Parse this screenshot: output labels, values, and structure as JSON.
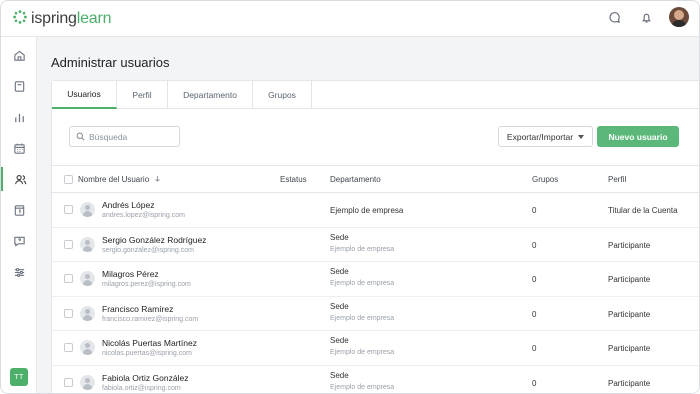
{
  "app": {
    "logo_prefix": "ispring",
    "logo_suffix": "learn"
  },
  "page": {
    "title": "Administrar usuarios"
  },
  "tabs": [
    {
      "label": "Usuarios",
      "active": true
    },
    {
      "label": "Perfil",
      "active": false
    },
    {
      "label": "Departamento",
      "active": false
    },
    {
      "label": "Grupos",
      "active": false
    }
  ],
  "search": {
    "placeholder": "Búsqueda"
  },
  "toolbar": {
    "export_label": "Exportar/Importar",
    "new_user_label": "Nuevo usuario"
  },
  "table": {
    "columns": {
      "name": "Nombre del Usuario",
      "status": "Estatus",
      "department": "Departamento",
      "groups": "Grupos",
      "profile": "Perfil"
    },
    "rows": [
      {
        "name": "Andrés López",
        "email": "andres.lopez@ispring.com",
        "department": "Ejemplo de empresa",
        "department_sub": "",
        "groups": "0",
        "profile": "Titular de la Cuenta"
      },
      {
        "name": "Sergio González Rodríguez",
        "email": "sergio.gonzalez@ispring.com",
        "department": "Sede",
        "department_sub": "Ejemplo de empresa",
        "groups": "0",
        "profile": "Participante"
      },
      {
        "name": "Milagros Pérez",
        "email": "milagros.perez@ispring.com",
        "department": "Sede",
        "department_sub": "Ejemplo de empresa",
        "groups": "0",
        "profile": "Participante"
      },
      {
        "name": "Francisco Ramírez",
        "email": "francisco.ramirez@ispring.com",
        "department": "Sede",
        "department_sub": "Ejemplo de empresa",
        "groups": "0",
        "profile": "Participante"
      },
      {
        "name": "Nicolás Puertas Martínez",
        "email": "nicolas.puertas@ispring.com",
        "department": "Sede",
        "department_sub": "Ejemplo de empresa",
        "groups": "0",
        "profile": "Participante"
      },
      {
        "name": "Fabiola Ortiz González",
        "email": "fabiola.ortiz@ispring.com",
        "department": "Sede",
        "department_sub": "Ejemplo de empresa",
        "groups": "0",
        "profile": "Participante"
      }
    ]
  },
  "user_badge": {
    "initials": "TT"
  },
  "colors": {
    "accent": "#4caf6a",
    "button": "#5cb87a",
    "background": "#f3f4f6"
  }
}
